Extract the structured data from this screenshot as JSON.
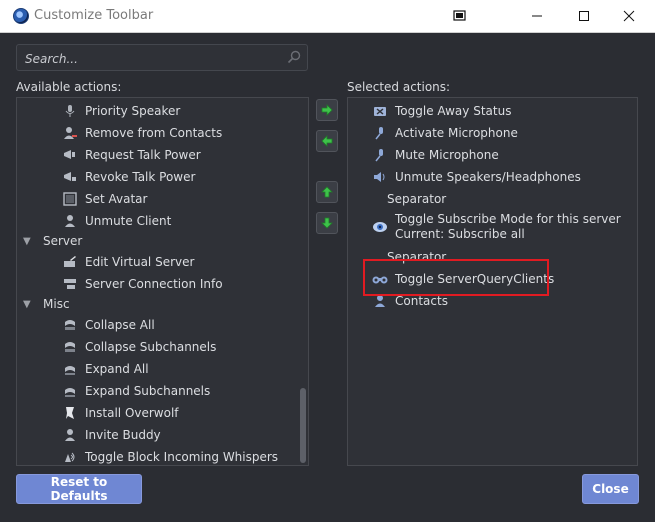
{
  "window": {
    "title": "Customize Toolbar"
  },
  "search": {
    "placeholder": "Search..."
  },
  "available": {
    "label": "Available actions:",
    "items_top": [
      {
        "label": "Priority Speaker",
        "icon": "mic-star-icon"
      },
      {
        "label": "Remove from Contacts",
        "icon": "contact-remove-icon"
      },
      {
        "label": "Request Talk Power",
        "icon": "megaphone-up-icon"
      },
      {
        "label": "Revoke Talk Power",
        "icon": "megaphone-down-icon"
      },
      {
        "label": "Set Avatar",
        "icon": "avatar-icon"
      },
      {
        "label": "Unmute Client",
        "icon": "user-unmute-icon"
      }
    ],
    "group_server": {
      "label": "Server",
      "items": [
        {
          "label": "Edit Virtual Server",
          "icon": "server-edit-icon"
        },
        {
          "label": "Server Connection Info",
          "icon": "server-info-icon"
        }
      ]
    },
    "group_misc": {
      "label": "Misc",
      "items": [
        {
          "label": "Collapse All",
          "icon": "collapse-all-icon"
        },
        {
          "label": "Collapse Subchannels",
          "icon": "collapse-sub-icon"
        },
        {
          "label": "Expand All",
          "icon": "expand-all-icon"
        },
        {
          "label": "Expand Subchannels",
          "icon": "expand-sub-icon"
        },
        {
          "label": "Install Overwolf",
          "icon": "overwolf-icon"
        },
        {
          "label": "Invite Buddy",
          "icon": "invite-buddy-icon"
        },
        {
          "label": "Toggle Block Incoming Whispers",
          "icon": "whisper-block-icon"
        }
      ]
    }
  },
  "selected": {
    "label": "Selected actions:",
    "items": [
      {
        "label": "Toggle Away Status",
        "icon": "away-icon"
      },
      {
        "label": "Activate Microphone",
        "icon": "mic-icon"
      },
      {
        "label": "Mute Microphone",
        "icon": "mic-mute-icon"
      },
      {
        "label": "Unmute Speakers/Headphones",
        "icon": "speaker-unmute-icon"
      },
      {
        "label": "Separator",
        "icon": ""
      },
      {
        "label": "Toggle Subscribe Mode for this server",
        "label2": "Current: Subscribe all",
        "icon": "eye-icon"
      },
      {
        "label": "Separator",
        "icon": ""
      },
      {
        "label": "Toggle ServerQueryClients",
        "icon": "binoculars-icon"
      },
      {
        "label": "Contacts",
        "icon": "contacts-icon"
      }
    ]
  },
  "buttons": {
    "reset": "Reset to Defaults",
    "close": "Close"
  },
  "colors": {
    "accent": "#6f87d3",
    "highlight": "#e11b22",
    "arrow_green": "#3ec24a"
  }
}
